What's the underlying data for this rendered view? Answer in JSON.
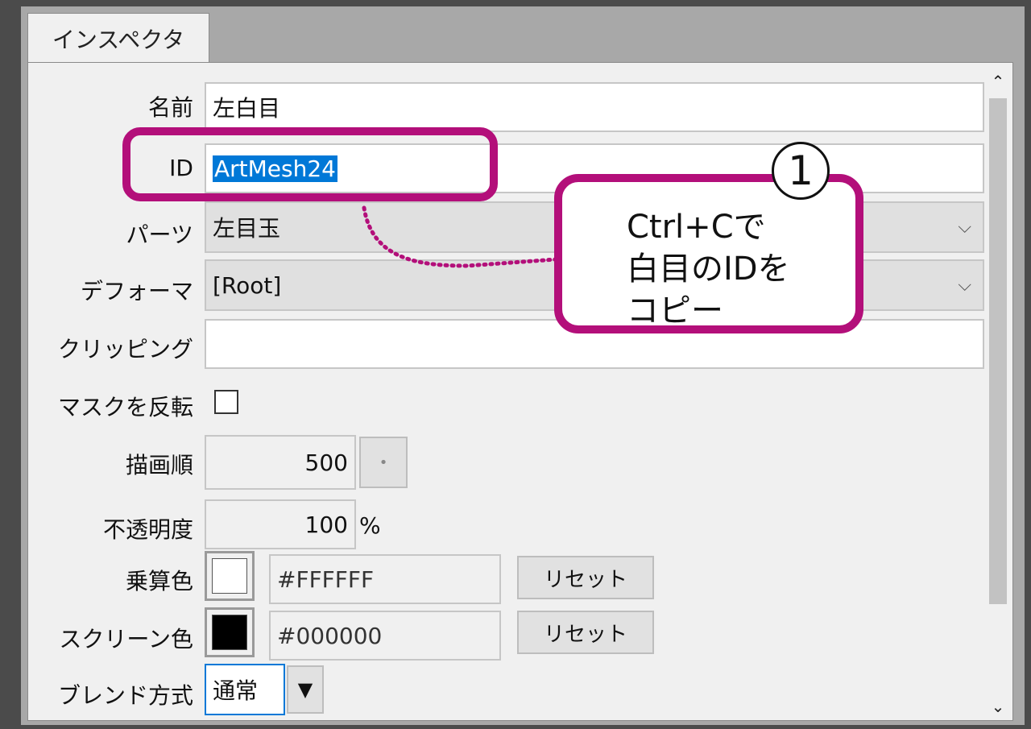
{
  "inspector": {
    "tab_label": "インスペクタ",
    "fields": {
      "name": {
        "label": "名前",
        "value": "左白目"
      },
      "id": {
        "label": "ID",
        "value": "ArtMesh24"
      },
      "parts": {
        "label": "パーツ",
        "value": "左目玉"
      },
      "deformer": {
        "label": "デフォーマ",
        "value": "[Root]"
      },
      "clipping": {
        "label": "クリッピング",
        "value": ""
      },
      "invert_mask": {
        "label": "マスクを反転",
        "checked": false
      },
      "draw_order": {
        "label": "描画順",
        "value": "500",
        "button": "•"
      },
      "opacity": {
        "label": "不透明度",
        "value": "100",
        "unit": "%"
      },
      "multiply_color": {
        "label": "乗算色",
        "hex": "#FFFFFF",
        "swatch": "#ffffff",
        "reset": "リセット"
      },
      "screen_color": {
        "label": "スクリーン色",
        "hex": "#000000",
        "swatch": "#000000",
        "reset": "リセット"
      },
      "blend_mode": {
        "label": "ブレンド方式",
        "value": "通常"
      }
    }
  },
  "annotation": {
    "badge": "1",
    "lines": [
      "Ctrl+Cで",
      "白目のIDを",
      "コピー"
    ],
    "color": "#b30f7a"
  }
}
